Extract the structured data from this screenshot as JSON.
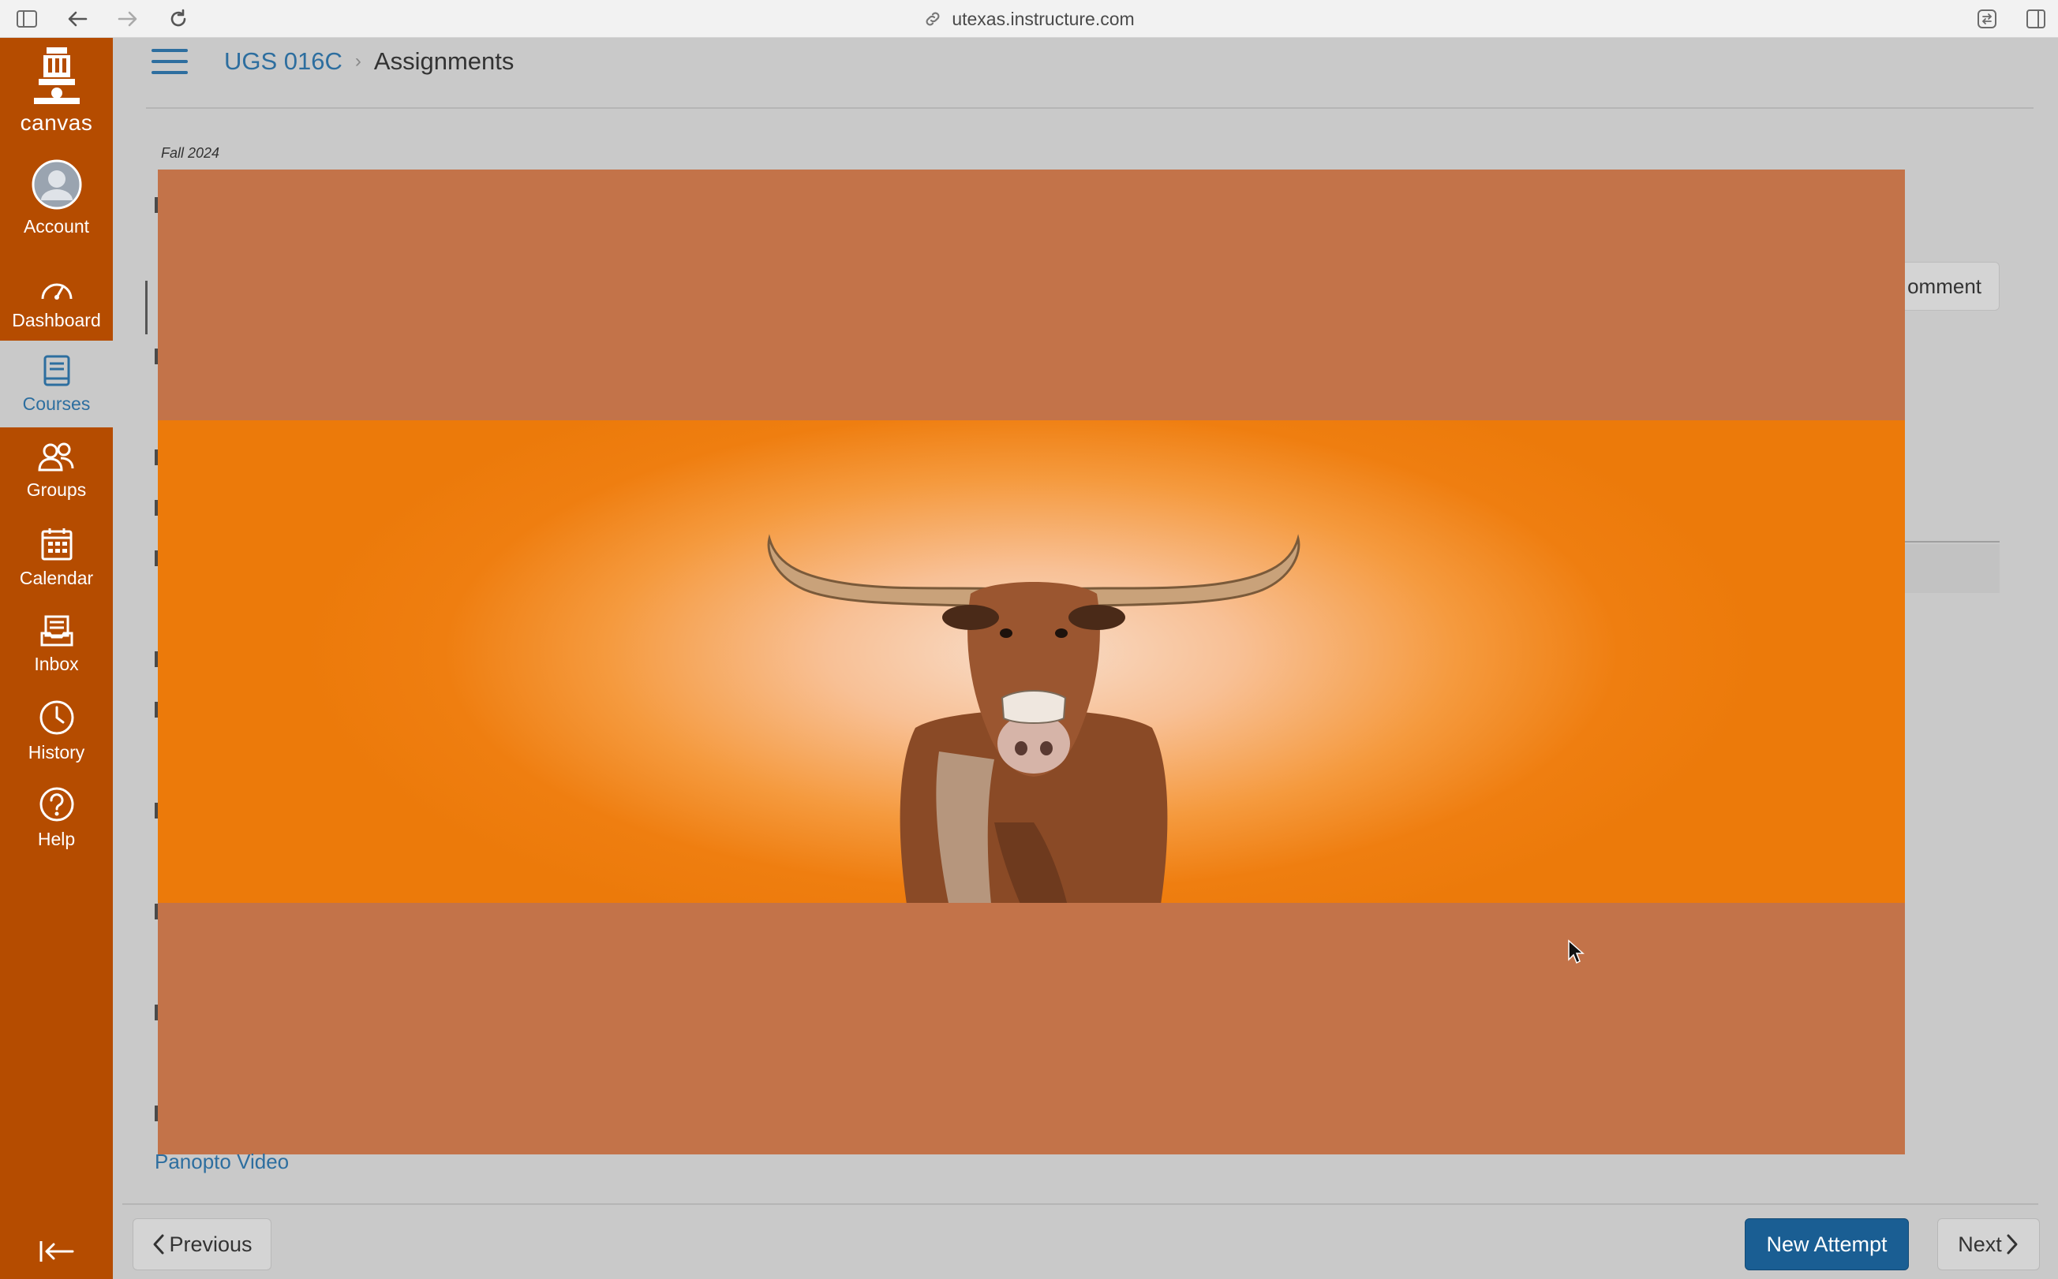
{
  "browser": {
    "url": "utexas.instructure.com",
    "icons": [
      "sidebar-toggle-icon",
      "back-arrow-icon",
      "forward-arrow-icon",
      "reload-icon",
      "link-icon",
      "extension-icon",
      "split-view-icon"
    ]
  },
  "global_nav": {
    "logo_label": "canvas",
    "items": [
      {
        "label": "Account",
        "icon": "avatar-icon"
      },
      {
        "label": "Dashboard",
        "icon": "dashboard-gauge-icon"
      },
      {
        "label": "Courses",
        "icon": "book-icon",
        "active": true
      },
      {
        "label": "Groups",
        "icon": "groups-icon"
      },
      {
        "label": "Calendar",
        "icon": "calendar-icon"
      },
      {
        "label": "Inbox",
        "icon": "inbox-icon"
      },
      {
        "label": "History",
        "icon": "clock-icon"
      },
      {
        "label": "Help",
        "icon": "help-icon"
      }
    ],
    "collapse_icon": "collapse-nav-icon",
    "colors": {
      "nav_bg": "#b54c00",
      "active_text": "#2d6e9f"
    }
  },
  "header": {
    "breadcrumb": {
      "course": "UGS 016C",
      "current": "Assignments"
    }
  },
  "content": {
    "term": "Fall 2024",
    "comment_button_partial": "omment",
    "media_link": "Panopto Video"
  },
  "video": {
    "description_colors": {
      "frame_bg": "#c37349",
      "band_orange": "#ec7a0a"
    }
  },
  "footer": {
    "previous_label": "Previous",
    "new_attempt_label": "New Attempt",
    "next_label": "Next",
    "colors": {
      "primary": "#1a5e93"
    }
  }
}
